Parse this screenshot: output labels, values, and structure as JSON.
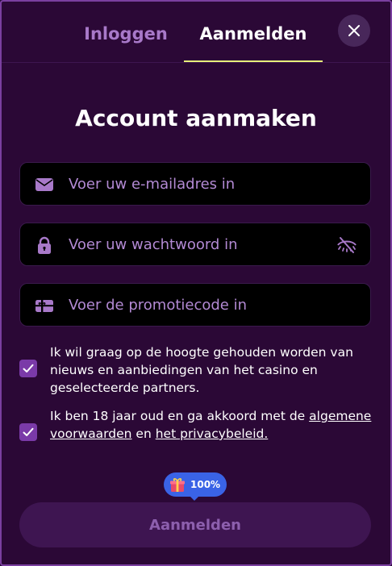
{
  "tabs": {
    "login_label": "Inloggen",
    "register_label": "Aanmelden",
    "active": "register"
  },
  "close": {
    "icon": "close-icon"
  },
  "form": {
    "title": "Account aanmaken",
    "email": {
      "placeholder": "Voer uw e-mailadres in",
      "value": "",
      "icon": "envelope-icon"
    },
    "password": {
      "placeholder": "Voer uw wachtwoord in",
      "value": "",
      "icon": "lock-icon",
      "toggle_icon": "eye-off-icon"
    },
    "promo": {
      "placeholder": "Voer de promotiecode in",
      "value": "",
      "icon": "gift-card-icon"
    },
    "newsletter": {
      "checked": true,
      "text": "Ik wil graag op de hoogte gehouden worden van nieuws en aanbiedingen van het casino en geselecteerde partners."
    },
    "terms": {
      "checked": true,
      "text_before": "Ik ben 18 jaar oud en ga akkoord met de",
      "terms_link": "algemene voorwaarden",
      "text_middle": "en",
      "privacy_link": "het privacybeleid."
    },
    "bonus": {
      "icon": "gift-icon",
      "percent": "100%"
    },
    "submit_label": "Aanmelden"
  },
  "colors": {
    "background": "#2b0836",
    "accent": "#7a3aa8",
    "tab_underline": "#e7ee7a",
    "bonus_badge": "#3a63e6"
  }
}
